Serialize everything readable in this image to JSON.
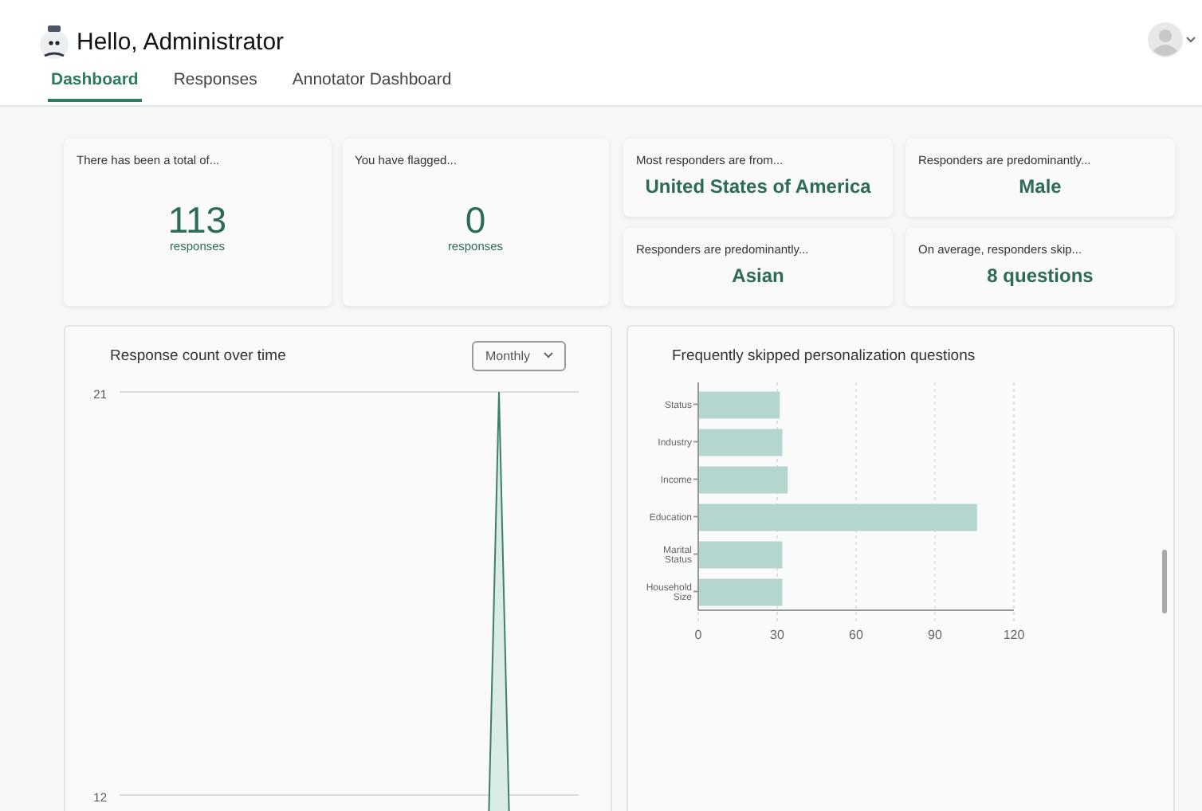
{
  "header": {
    "greeting": "Hello, Administrator"
  },
  "tabs": [
    {
      "label": "Dashboard",
      "selected": true
    },
    {
      "label": "Responses",
      "selected": false
    },
    {
      "label": "Annotator Dashboard",
      "selected": false
    }
  ],
  "big_stats": [
    {
      "caption": "There has been a total of...",
      "value": "113",
      "unit": "responses"
    },
    {
      "caption": "You have flagged...",
      "value": "0",
      "unit": "responses"
    }
  ],
  "small_stats": [
    {
      "caption": "Most responders are from...",
      "value": "United States of America"
    },
    {
      "caption": "Responders are predominantly...",
      "value": "Male"
    },
    {
      "caption": "Responders are predominantly...",
      "value": "Asian"
    },
    {
      "caption": "On average, responders skip...",
      "value": "8 questions"
    }
  ],
  "line_panel": {
    "title": "Response count over time",
    "dropdown": "Monthly",
    "y_tick_labels": [
      "21",
      "12"
    ]
  },
  "bar_panel": {
    "title": "Frequently skipped personalization questions",
    "chart_data": {
      "type": "bar",
      "orientation": "horizontal",
      "categories": [
        "Status",
        "Industry",
        "Income",
        "Education",
        "Marital Status",
        "Household Size"
      ],
      "series": [
        {
          "color": "#b5d6cf",
          "values": [
            31,
            32,
            34,
            106,
            32,
            32
          ]
        }
      ],
      "grid": true,
      "xlim": [
        0,
        120
      ],
      "xticks": [
        0,
        30,
        60,
        90,
        120
      ]
    }
  }
}
